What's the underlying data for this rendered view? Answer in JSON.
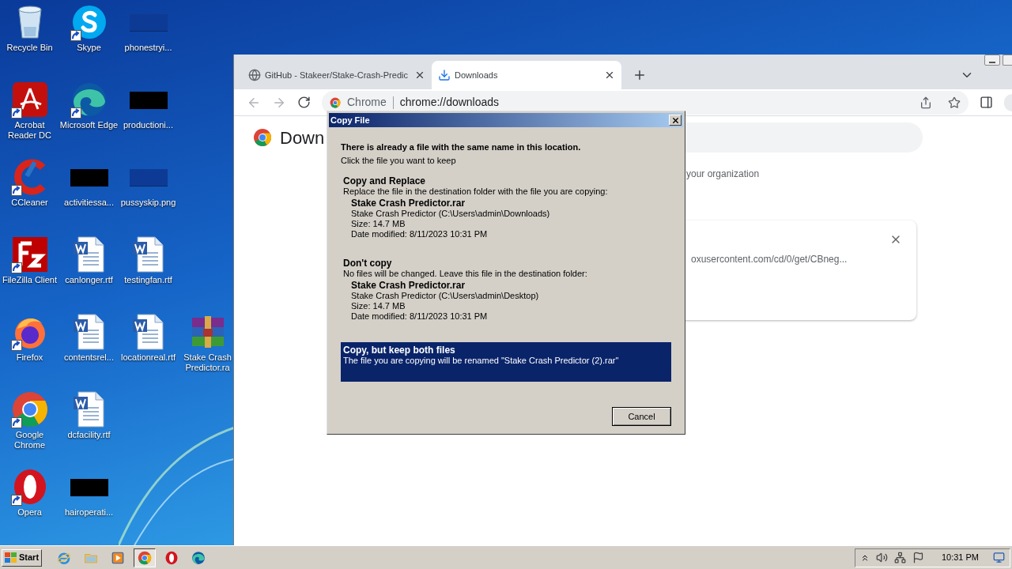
{
  "desktop_icons": [
    {
      "label": "Recycle Bin",
      "kind": "recycle-bin",
      "shortcut": false
    },
    {
      "label": "Acrobat Reader DC",
      "kind": "acrobat",
      "shortcut": true
    },
    {
      "label": "CCleaner",
      "kind": "ccleaner",
      "shortcut": true
    },
    {
      "label": "FileZilla Client",
      "kind": "filezilla",
      "shortcut": true
    },
    {
      "label": "Firefox",
      "kind": "firefox",
      "shortcut": true
    },
    {
      "label": "Google Chrome",
      "kind": "chrome",
      "shortcut": true
    },
    {
      "label": "Opera",
      "kind": "opera",
      "shortcut": true
    },
    {
      "label": "Skype",
      "kind": "skype",
      "shortcut": true
    },
    {
      "label": "Microsoft Edge",
      "kind": "edge",
      "shortcut": true
    },
    {
      "label": "activitiessa...",
      "kind": "redacted",
      "shortcut": false
    },
    {
      "label": "canlonger.rtf",
      "kind": "word",
      "shortcut": false
    },
    {
      "label": "contentsrel...",
      "kind": "word",
      "shortcut": false
    },
    {
      "label": "dcfacility.rtf",
      "kind": "word",
      "shortcut": false
    },
    {
      "label": "hairoperati...",
      "kind": "redacted",
      "shortcut": false
    },
    {
      "label": "phonestryi...",
      "kind": "blank",
      "shortcut": false
    },
    {
      "label": "productioni...",
      "kind": "redacted",
      "shortcut": false
    },
    {
      "label": "pussyskip.png",
      "kind": "blank",
      "shortcut": false
    },
    {
      "label": "testingfan.rtf",
      "kind": "word",
      "shortcut": false
    },
    {
      "label": "locationreal.rtf",
      "kind": "word",
      "shortcut": false
    },
    {
      "label": "Stake Crash Predictor.ra",
      "kind": "winrar",
      "shortcut": false
    }
  ],
  "browser": {
    "tabs": [
      {
        "title": "GitHub - Stakeer/Stake-Crash-Predic",
        "kind": "globe",
        "selected": false
      },
      {
        "title": "Downloads",
        "kind": "download",
        "selected": true
      }
    ],
    "omnibox": {
      "chip": "Chrome",
      "url": "chrome://downloads"
    },
    "page": {
      "title": "Down",
      "notice": "your organization",
      "download_url": "oxusercontent.com/cd/0/get/CBneg..."
    }
  },
  "dialog": {
    "title": "Copy File",
    "heading": "There is already a file with the same name in this location.",
    "subheading": "Click the file you want to keep",
    "options": [
      {
        "title": "Copy and Replace",
        "description": "Replace the file in the destination folder with the file you are copying:",
        "file": {
          "name": "Stake Crash Predictor.rar",
          "location": "Stake Crash Predictor (C:\\Users\\admin\\Downloads)",
          "size": "Size: 14.7 MB",
          "modified": "Date modified: 8/11/2023 10:31 PM"
        },
        "selected": false
      },
      {
        "title": "Don't copy",
        "description": "No files will be changed. Leave this file in the destination folder:",
        "file": {
          "name": "Stake Crash Predictor.rar",
          "location": "Stake Crash Predictor (C:\\Users\\admin\\Desktop)",
          "size": "Size: 14.7 MB",
          "modified": "Date modified: 8/11/2023 10:31 PM"
        },
        "selected": false
      },
      {
        "title": "Copy, but keep both files",
        "description": "The file you are copying will be renamed \"Stake Crash Predictor (2).rar\"",
        "selected": true
      }
    ],
    "buttons": [
      "Cancel"
    ]
  },
  "taskbar": {
    "start": "Start",
    "apps": [
      {
        "kind": "ie",
        "active": false
      },
      {
        "kind": "explorer",
        "active": false
      },
      {
        "kind": "media",
        "active": false
      },
      {
        "kind": "chrome",
        "active": true
      },
      {
        "kind": "opera",
        "active": false
      },
      {
        "kind": "edge",
        "active": false
      }
    ],
    "clock": "10:31 PM"
  }
}
